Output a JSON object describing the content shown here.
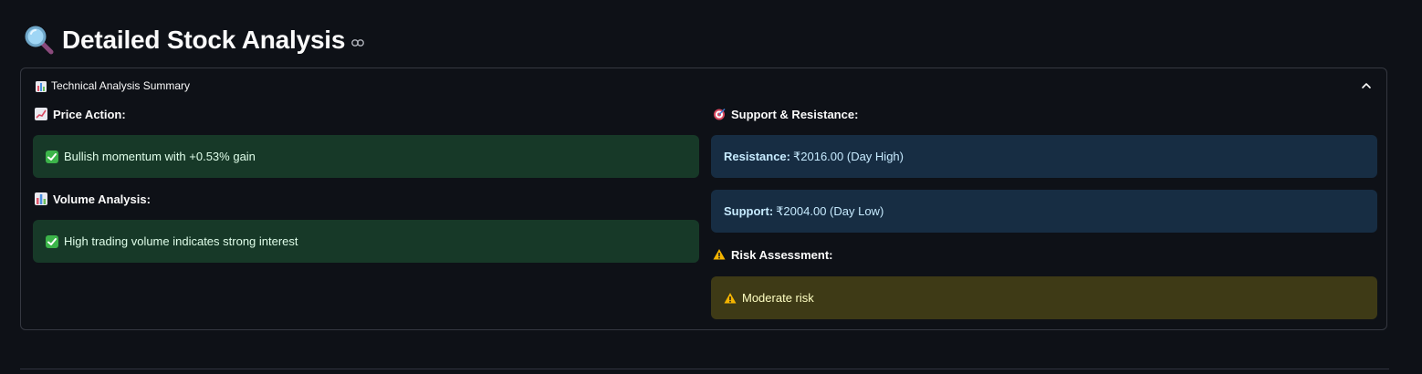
{
  "header": {
    "icon": "magnifying-glass-icon",
    "title": "Detailed Stock Analysis",
    "anchor_icon": "link-icon"
  },
  "expander": {
    "icon": "bar-chart-icon",
    "label": "Technical Analysis Summary",
    "state": "expanded",
    "toggle_icon": "chevron-up-icon"
  },
  "left": {
    "price_action": {
      "heading": "Price Action:",
      "icon": "chart-increasing-icon",
      "alert": {
        "icon": "check-mark-icon",
        "text": "Bullish momentum with +0.53% gain"
      }
    },
    "volume": {
      "heading": "Volume Analysis:",
      "icon": "bar-chart-icon",
      "alert": {
        "icon": "check-mark-icon",
        "text": "High trading volume indicates strong interest"
      }
    }
  },
  "right": {
    "support_resistance": {
      "heading": "Support & Resistance:",
      "icon": "target-icon",
      "resistance": {
        "label": "Resistance:",
        "value": "₹2016.00 (Day High)"
      },
      "support": {
        "label": "Support:",
        "value": "₹2004.00 (Day Low)"
      }
    },
    "risk": {
      "heading": "Risk Assessment:",
      "icon": "warning-icon",
      "alert": {
        "icon": "warning-icon",
        "text": "Moderate risk"
      }
    }
  },
  "colors": {
    "background": "#0e1117",
    "success_bg": "#173928",
    "info_bg": "#172d43",
    "warning_bg": "#3e3a16"
  }
}
